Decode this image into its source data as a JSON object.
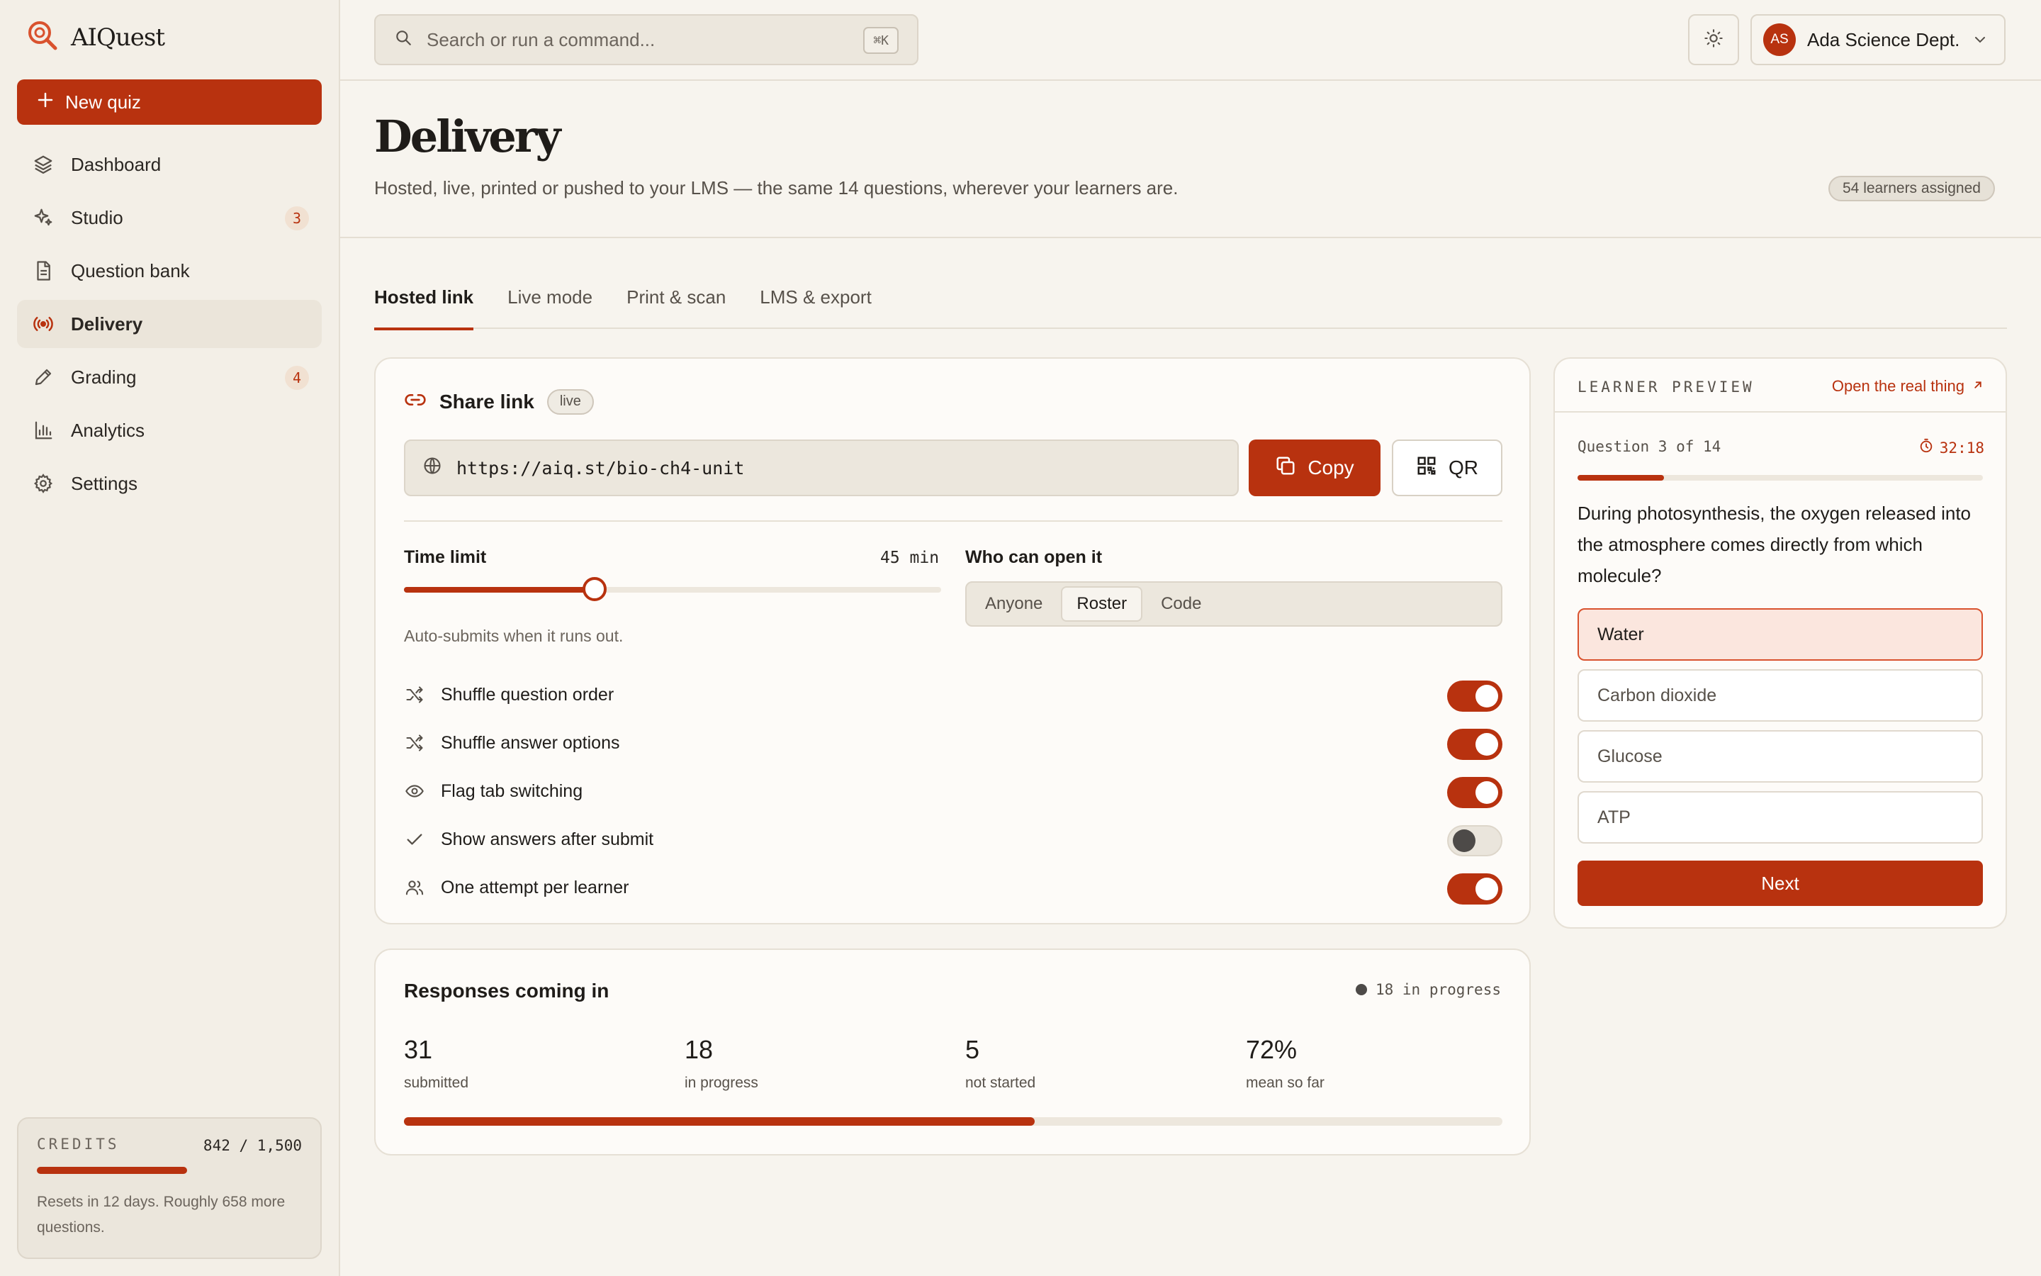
{
  "app": {
    "name": "AIQuest",
    "accent": "#b8320f"
  },
  "sidebar": {
    "new_quiz_label": "New quiz",
    "items": [
      {
        "label": "Dashboard",
        "icon": "layers-icon",
        "badge": ""
      },
      {
        "label": "Studio",
        "icon": "sparkles-icon",
        "badge": "3"
      },
      {
        "label": "Question bank",
        "icon": "document-icon",
        "badge": ""
      },
      {
        "label": "Delivery",
        "icon": "broadcast-icon",
        "badge": "",
        "active": true
      },
      {
        "label": "Grading",
        "icon": "pencil-icon",
        "badge": "4"
      },
      {
        "label": "Analytics",
        "icon": "bar-chart-icon",
        "badge": ""
      },
      {
        "label": "Settings",
        "icon": "gear-icon",
        "badge": ""
      }
    ],
    "credits": {
      "label": "CREDITS",
      "count": "842 / 1,500",
      "used_fraction": 0.561,
      "note": "Resets in 12 days. Roughly 658 more questions."
    }
  },
  "topbar": {
    "search_placeholder": "Search or run a command...",
    "shortcut": "⌘K",
    "account": {
      "initials": "AS",
      "name": "Ada Science Dept."
    }
  },
  "page": {
    "title": "Delivery",
    "subtitle": "Hosted, live, printed or pushed to your LMS — the same 14 questions, wherever your learners are.",
    "learners_pill": "54 learners assigned"
  },
  "tabs": [
    "Hosted link",
    "Live mode",
    "Print & scan",
    "LMS & export"
  ],
  "share": {
    "title": "Share link",
    "status": "live",
    "url": "https://aiq.st/bio-ch4-unit",
    "copy_label": "Copy",
    "qr_label": "QR",
    "time_limit": {
      "label": "Time limit",
      "value_label": "45 min",
      "fraction": 0.355,
      "note": "Auto-submits when it runs out."
    },
    "access": {
      "label": "Who can open it",
      "options": [
        "Anyone",
        "Roster",
        "Code"
      ],
      "selected": "Roster"
    },
    "toggles": [
      {
        "label": "Shuffle question order",
        "icon": "shuffle-icon",
        "on": true
      },
      {
        "label": "Shuffle answer options",
        "icon": "shuffle-icon",
        "on": true
      },
      {
        "label": "Flag tab switching",
        "icon": "eye-icon",
        "on": true
      },
      {
        "label": "Show answers after submit",
        "icon": "check-icon",
        "on": false
      },
      {
        "label": "One attempt per learner",
        "icon": "users-icon",
        "on": true
      }
    ]
  },
  "responses": {
    "title": "Responses coming in",
    "status": "18 in progress",
    "stats": [
      {
        "value": "31",
        "label": "submitted"
      },
      {
        "value": "18",
        "label": "in progress"
      },
      {
        "value": "5",
        "label": "not started"
      },
      {
        "value": "72%",
        "label": "mean so far"
      }
    ],
    "submitted_fraction": 0.574
  },
  "preview": {
    "label": "LEARNER PREVIEW",
    "open_label": "Open the real thing",
    "question_number": "Question 3 of 14",
    "timer": "32:18",
    "progress_fraction": 0.214,
    "question": "During photosynthesis, the oxygen released into the atmosphere comes directly from which molecule?",
    "options": [
      "Water",
      "Carbon dioxide",
      "Glucose",
      "ATP"
    ],
    "selected": "Water",
    "next_label": "Next"
  }
}
